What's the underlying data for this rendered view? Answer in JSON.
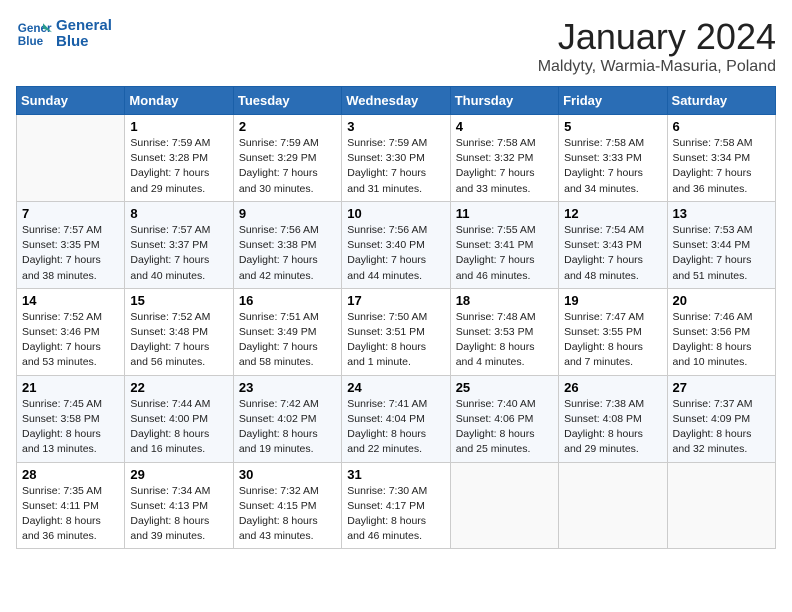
{
  "header": {
    "logo_line1": "General",
    "logo_line2": "Blue",
    "month": "January 2024",
    "location": "Maldyty, Warmia-Masuria, Poland"
  },
  "weekdays": [
    "Sunday",
    "Monday",
    "Tuesday",
    "Wednesday",
    "Thursday",
    "Friday",
    "Saturday"
  ],
  "weeks": [
    [
      {
        "day": "",
        "info": ""
      },
      {
        "day": "1",
        "info": "Sunrise: 7:59 AM\nSunset: 3:28 PM\nDaylight: 7 hours\nand 29 minutes."
      },
      {
        "day": "2",
        "info": "Sunrise: 7:59 AM\nSunset: 3:29 PM\nDaylight: 7 hours\nand 30 minutes."
      },
      {
        "day": "3",
        "info": "Sunrise: 7:59 AM\nSunset: 3:30 PM\nDaylight: 7 hours\nand 31 minutes."
      },
      {
        "day": "4",
        "info": "Sunrise: 7:58 AM\nSunset: 3:32 PM\nDaylight: 7 hours\nand 33 minutes."
      },
      {
        "day": "5",
        "info": "Sunrise: 7:58 AM\nSunset: 3:33 PM\nDaylight: 7 hours\nand 34 minutes."
      },
      {
        "day": "6",
        "info": "Sunrise: 7:58 AM\nSunset: 3:34 PM\nDaylight: 7 hours\nand 36 minutes."
      }
    ],
    [
      {
        "day": "7",
        "info": "Sunrise: 7:57 AM\nSunset: 3:35 PM\nDaylight: 7 hours\nand 38 minutes."
      },
      {
        "day": "8",
        "info": "Sunrise: 7:57 AM\nSunset: 3:37 PM\nDaylight: 7 hours\nand 40 minutes."
      },
      {
        "day": "9",
        "info": "Sunrise: 7:56 AM\nSunset: 3:38 PM\nDaylight: 7 hours\nand 42 minutes."
      },
      {
        "day": "10",
        "info": "Sunrise: 7:56 AM\nSunset: 3:40 PM\nDaylight: 7 hours\nand 44 minutes."
      },
      {
        "day": "11",
        "info": "Sunrise: 7:55 AM\nSunset: 3:41 PM\nDaylight: 7 hours\nand 46 minutes."
      },
      {
        "day": "12",
        "info": "Sunrise: 7:54 AM\nSunset: 3:43 PM\nDaylight: 7 hours\nand 48 minutes."
      },
      {
        "day": "13",
        "info": "Sunrise: 7:53 AM\nSunset: 3:44 PM\nDaylight: 7 hours\nand 51 minutes."
      }
    ],
    [
      {
        "day": "14",
        "info": "Sunrise: 7:52 AM\nSunset: 3:46 PM\nDaylight: 7 hours\nand 53 minutes."
      },
      {
        "day": "15",
        "info": "Sunrise: 7:52 AM\nSunset: 3:48 PM\nDaylight: 7 hours\nand 56 minutes."
      },
      {
        "day": "16",
        "info": "Sunrise: 7:51 AM\nSunset: 3:49 PM\nDaylight: 7 hours\nand 58 minutes."
      },
      {
        "day": "17",
        "info": "Sunrise: 7:50 AM\nSunset: 3:51 PM\nDaylight: 8 hours\nand 1 minute."
      },
      {
        "day": "18",
        "info": "Sunrise: 7:48 AM\nSunset: 3:53 PM\nDaylight: 8 hours\nand 4 minutes."
      },
      {
        "day": "19",
        "info": "Sunrise: 7:47 AM\nSunset: 3:55 PM\nDaylight: 8 hours\nand 7 minutes."
      },
      {
        "day": "20",
        "info": "Sunrise: 7:46 AM\nSunset: 3:56 PM\nDaylight: 8 hours\nand 10 minutes."
      }
    ],
    [
      {
        "day": "21",
        "info": "Sunrise: 7:45 AM\nSunset: 3:58 PM\nDaylight: 8 hours\nand 13 minutes."
      },
      {
        "day": "22",
        "info": "Sunrise: 7:44 AM\nSunset: 4:00 PM\nDaylight: 8 hours\nand 16 minutes."
      },
      {
        "day": "23",
        "info": "Sunrise: 7:42 AM\nSunset: 4:02 PM\nDaylight: 8 hours\nand 19 minutes."
      },
      {
        "day": "24",
        "info": "Sunrise: 7:41 AM\nSunset: 4:04 PM\nDaylight: 8 hours\nand 22 minutes."
      },
      {
        "day": "25",
        "info": "Sunrise: 7:40 AM\nSunset: 4:06 PM\nDaylight: 8 hours\nand 25 minutes."
      },
      {
        "day": "26",
        "info": "Sunrise: 7:38 AM\nSunset: 4:08 PM\nDaylight: 8 hours\nand 29 minutes."
      },
      {
        "day": "27",
        "info": "Sunrise: 7:37 AM\nSunset: 4:09 PM\nDaylight: 8 hours\nand 32 minutes."
      }
    ],
    [
      {
        "day": "28",
        "info": "Sunrise: 7:35 AM\nSunset: 4:11 PM\nDaylight: 8 hours\nand 36 minutes."
      },
      {
        "day": "29",
        "info": "Sunrise: 7:34 AM\nSunset: 4:13 PM\nDaylight: 8 hours\nand 39 minutes."
      },
      {
        "day": "30",
        "info": "Sunrise: 7:32 AM\nSunset: 4:15 PM\nDaylight: 8 hours\nand 43 minutes."
      },
      {
        "day": "31",
        "info": "Sunrise: 7:30 AM\nSunset: 4:17 PM\nDaylight: 8 hours\nand 46 minutes."
      },
      {
        "day": "",
        "info": ""
      },
      {
        "day": "",
        "info": ""
      },
      {
        "day": "",
        "info": ""
      }
    ]
  ]
}
